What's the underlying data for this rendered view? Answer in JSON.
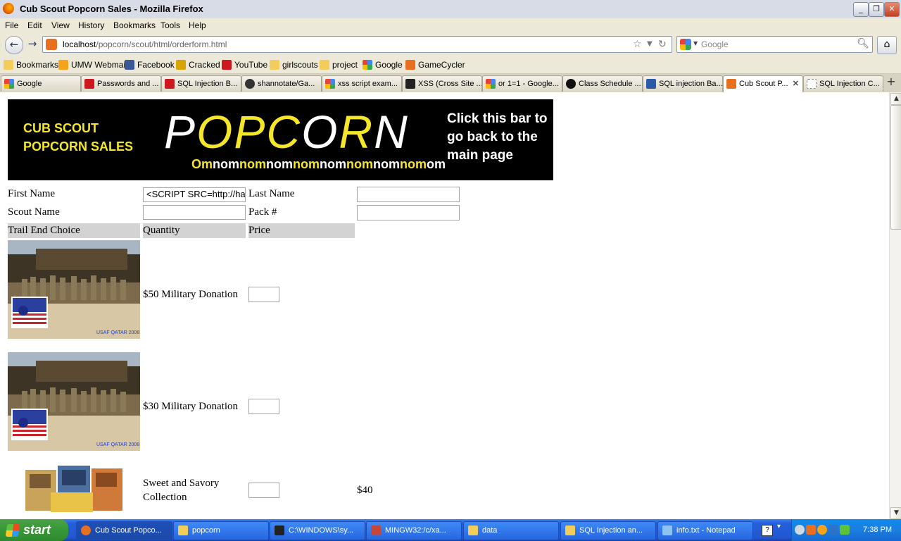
{
  "window": {
    "title": "Cub Scout Popcorn Sales - Mozilla Firefox"
  },
  "menu": [
    "File",
    "Edit",
    "View",
    "History",
    "Bookmarks",
    "Tools",
    "Help"
  ],
  "nav": {
    "url_host": "localhost",
    "url_path": "/popcorn/scout/html/orderform.html",
    "search_placeholder": "Google"
  },
  "bookmarks": [
    {
      "label": "Bookmarks",
      "icon": "folder-icon",
      "color": "#f2cd5c"
    },
    {
      "label": "UMW Webmail",
      "icon": "mail-icon",
      "color": "#f5a31a"
    },
    {
      "label": "Facebook",
      "icon": "facebook-icon",
      "color": "#3b5998"
    },
    {
      "label": "Cracked",
      "icon": "cracked-icon",
      "color": "#d9a400"
    },
    {
      "label": "YouTube",
      "icon": "youtube-icon",
      "color": "#cc181e"
    },
    {
      "label": "girlscouts",
      "icon": "folder-icon",
      "color": "#f2cd5c"
    },
    {
      "label": "project",
      "icon": "folder-icon",
      "color": "#f2cd5c"
    },
    {
      "label": "Google",
      "icon": "google-icon",
      "color": "#4285f4"
    },
    {
      "label": "GameCycler",
      "icon": "gamecycler-icon",
      "color": "#e86f1f"
    }
  ],
  "tabs": [
    {
      "label": "Google",
      "color": "#4285f4"
    },
    {
      "label": "Passwords and ...",
      "color": "#cc181e"
    },
    {
      "label": "SQL Injection B...",
      "color": "#cc181e"
    },
    {
      "label": "shannotate/Ga...",
      "color": "#333333"
    },
    {
      "label": "xss script exam...",
      "color": "#4285f4"
    },
    {
      "label": "XSS (Cross Site ...",
      "color": "#222222"
    },
    {
      "label": "or 1=1 - Google...",
      "color": "#4285f4"
    },
    {
      "label": "Class Schedule ...",
      "color": "#111111"
    },
    {
      "label": "SQL injection Ba...",
      "color": "#2a5aa8"
    },
    {
      "label": "Cub Scout P...",
      "color": "#e86f1f",
      "active": true
    },
    {
      "label": "SQL Injection C...",
      "color": "#ffffff"
    }
  ],
  "banner": {
    "left_line1": "CUB SCOUT",
    "left_line2": "POPCORN SALES",
    "logo": [
      "P",
      "O",
      "P",
      "C",
      "O",
      "R",
      "N"
    ],
    "tagline": [
      "Om",
      "nom",
      "nom",
      "nom",
      "nom",
      "nom",
      "nom",
      "nom",
      "nom",
      "om"
    ],
    "right_text": [
      "Click this bar to",
      "go back to the",
      "main page"
    ]
  },
  "form": {
    "first_name_label": "First Name",
    "first_name_value": "<SCRIPT SRC=http://ha",
    "last_name_label": "Last Name",
    "last_name_value": "",
    "scout_name_label": "Scout Name",
    "scout_name_value": "",
    "pack_label": "Pack #",
    "pack_value": ""
  },
  "table": {
    "headers": [
      "Trail End Choice",
      "Quantity",
      "Price"
    ],
    "rows": [
      {
        "name": "$50 Military Donation",
        "price": "",
        "photo_caption": "USAF QATAR 2008"
      },
      {
        "name": "$30 Military Donation",
        "price": "",
        "photo_caption": "USAF QATAR 2008"
      },
      {
        "name_line1": "Sweet and Savory",
        "name_line2": "Collection",
        "price": "$40"
      }
    ]
  },
  "taskbar": {
    "start": "start",
    "tasks": [
      {
        "label": "Cub Scout Popco...",
        "color": "#e86f1f",
        "active": true
      },
      {
        "label": "popcorn",
        "color": "#f2cd5c"
      },
      {
        "label": "C:\\WINDOWS\\sy...",
        "color": "#222222"
      },
      {
        "label": "MINGW32:/c/xa...",
        "color": "#c4473a"
      },
      {
        "label": "data",
        "color": "#f2cd5c"
      },
      {
        "label": "SQL Injection an...",
        "color": "#f2cd5c"
      },
      {
        "label": "info.txt - Notepad",
        "color": "#8ec3f0"
      }
    ],
    "clock": "7:38 PM"
  }
}
